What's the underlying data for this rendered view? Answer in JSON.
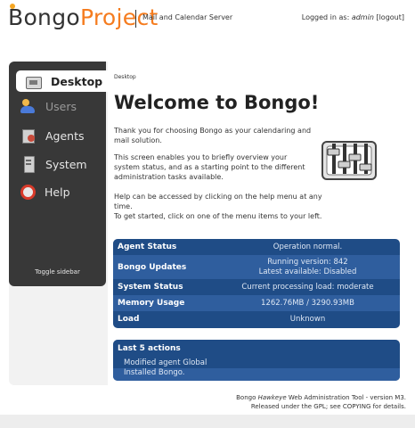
{
  "header": {
    "logo_part1": "Bongo",
    "logo_part2": "Project",
    "subtitle": "Mail and Calendar Server",
    "login_prefix": "Logged in as: ",
    "username": "admin",
    "logout_label": "[logout]"
  },
  "sidebar": {
    "items": [
      {
        "label": "Desktop",
        "icon": "desktop-icon"
      },
      {
        "label": "Users",
        "icon": "users-icon"
      },
      {
        "label": "Agents",
        "icon": "agents-icon"
      },
      {
        "label": "System",
        "icon": "system-icon"
      },
      {
        "label": "Help",
        "icon": "help-icon"
      }
    ],
    "active": "Desktop",
    "toggle_label": "Toggle sidebar"
  },
  "main": {
    "breadcrumb": "Desktop",
    "title": "Welcome to Bongo!",
    "paragraph1": "Thank you for choosing Bongo as your calendaring and mail solution.",
    "paragraph2": "This screen enables you to briefly overview your system status, and as a starting point to the different administration tasks available.",
    "paragraph3_line1": "Help can be accessed by clicking on the help menu at any time.",
    "paragraph3_line2": "To get started, click on one of the menu items to your left."
  },
  "status": {
    "rows": [
      {
        "label": "Agent Status",
        "value": "Operation normal.",
        "value2": ""
      },
      {
        "label": "Bongo Updates",
        "value": "Running version: 842",
        "value2": "Latest available: Disabled"
      },
      {
        "label": "System Status",
        "value": "Current processing load: moderate",
        "value2": ""
      },
      {
        "label": "Memory Usage",
        "value": "1262.76MB / 3290.93MB",
        "value2": ""
      },
      {
        "label": "Load",
        "value": "Unknown",
        "value2": ""
      }
    ]
  },
  "actions": {
    "title": "Last 5 actions",
    "items": [
      "Modified agent Global",
      "Installed Bongo."
    ]
  },
  "footer": {
    "line1_prefix": "Bongo ",
    "line1_italic": "Hawkeye",
    "line1_suffix": " Web Administration Tool - version M3.",
    "line2": "Released under the GPL; see COPYING for details."
  },
  "colors": {
    "accent": "#f57c1f",
    "status_dark": "#1f4c86",
    "status_light": "#2f5e9e",
    "sidebar": "#383838"
  }
}
